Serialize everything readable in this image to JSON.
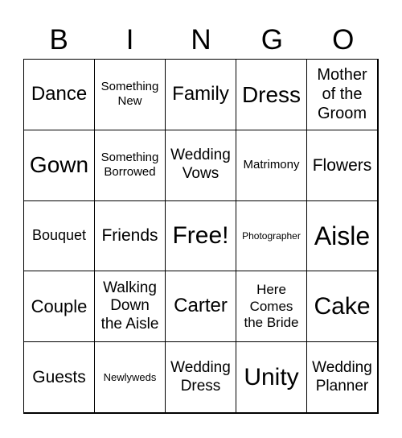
{
  "header": [
    "B",
    "I",
    "N",
    "G",
    "O"
  ],
  "cells": [
    {
      "text": "Dance",
      "size": 24
    },
    {
      "text": "Something New",
      "size": 15
    },
    {
      "text": "Family",
      "size": 24
    },
    {
      "text": "Dress",
      "size": 28
    },
    {
      "text": "Mother of the Groom",
      "size": 20
    },
    {
      "text": "Gown",
      "size": 28
    },
    {
      "text": "Something Borrowed",
      "size": 15
    },
    {
      "text": "Wedding Vows",
      "size": 19
    },
    {
      "text": "Matrimony",
      "size": 15
    },
    {
      "text": "Flowers",
      "size": 21
    },
    {
      "text": "Bouquet",
      "size": 18
    },
    {
      "text": "Friends",
      "size": 21
    },
    {
      "text": "Free!",
      "size": 30
    },
    {
      "text": "Photographer",
      "size": 12
    },
    {
      "text": "Aisle",
      "size": 32
    },
    {
      "text": "Couple",
      "size": 22
    },
    {
      "text": "Walking Down the Aisle",
      "size": 19
    },
    {
      "text": "Carter",
      "size": 24
    },
    {
      "text": "Here Comes the Bride",
      "size": 17
    },
    {
      "text": "Cake",
      "size": 30
    },
    {
      "text": "Guests",
      "size": 21
    },
    {
      "text": "Newlyweds",
      "size": 13
    },
    {
      "text": "Wedding Dress",
      "size": 19
    },
    {
      "text": "Unity",
      "size": 30
    },
    {
      "text": "Wedding Planner",
      "size": 19
    }
  ]
}
